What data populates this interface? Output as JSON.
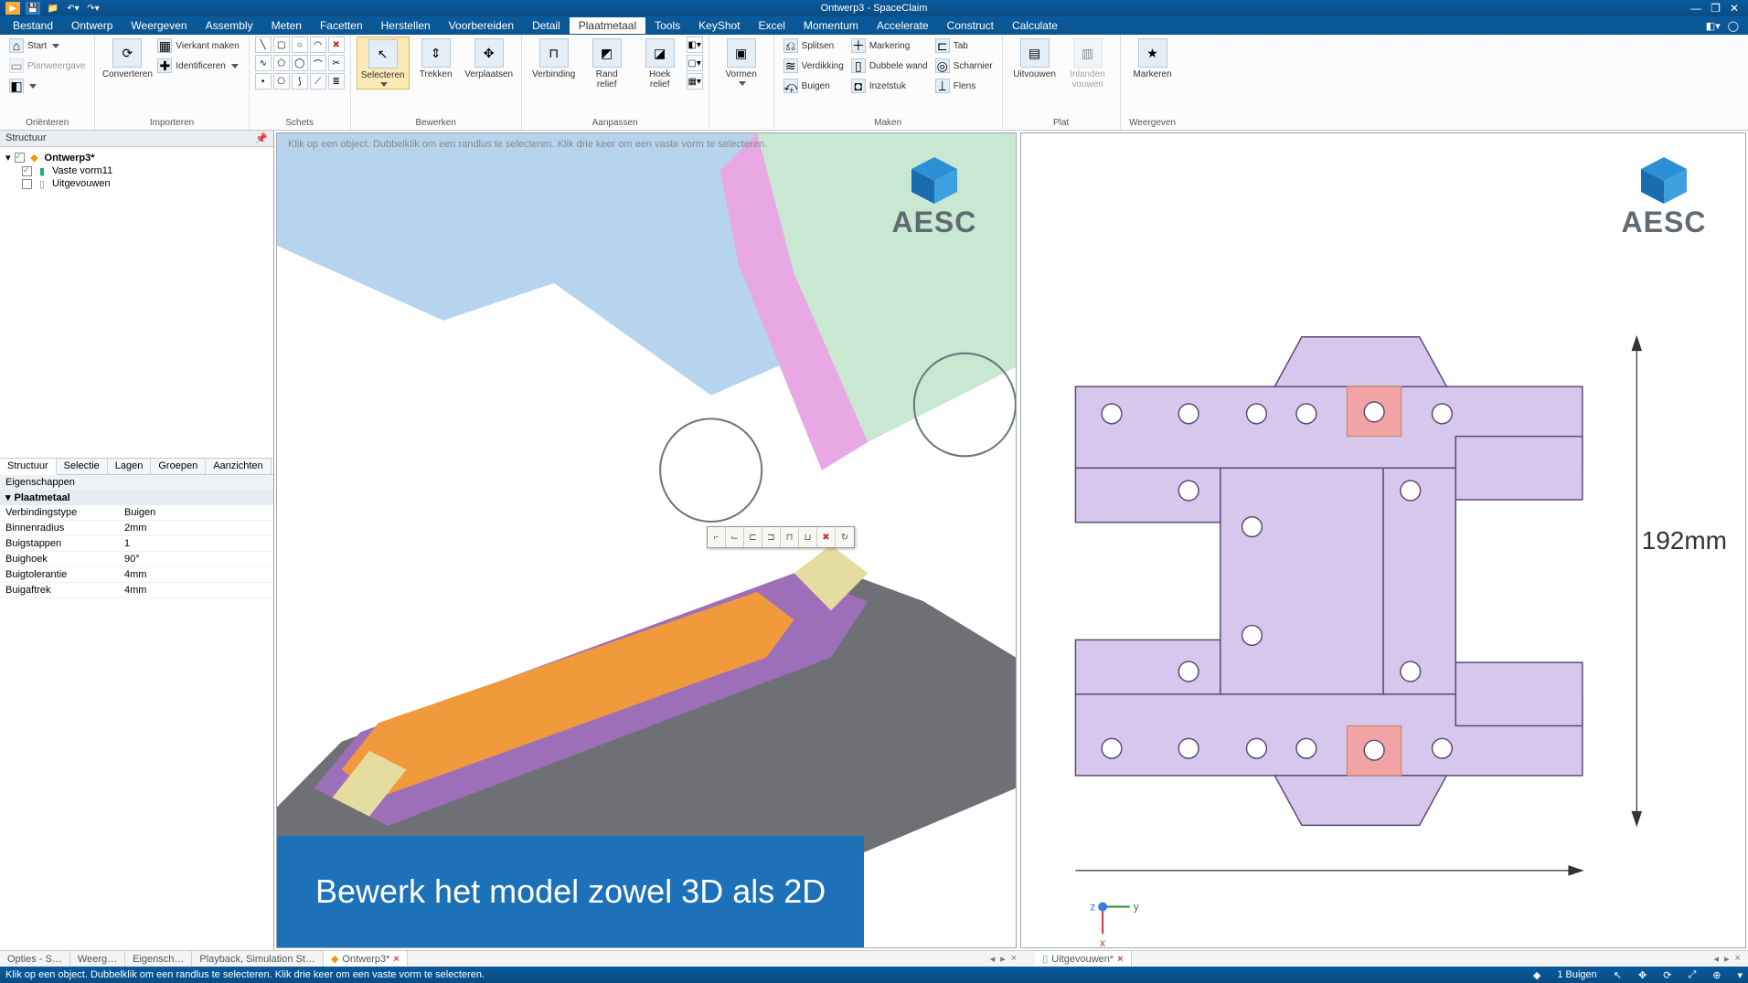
{
  "title": "Ontwerp3 - SpaceClaim",
  "menubar": [
    "Bestand",
    "Ontwerp",
    "Weergeven",
    "Assembly",
    "Meten",
    "Facetten",
    "Herstellen",
    "Voorbereiden",
    "Detail",
    "Plaatmetaal",
    "Tools",
    "KeyShot",
    "Excel",
    "Momentum",
    "Accelerate",
    "Construct",
    "Calculate"
  ],
  "menubar_active_index": 9,
  "ribbon": {
    "orienteren": {
      "start": "Start",
      "planweergave": "Planweergave",
      "orienteren_label": "Oriënteren"
    },
    "importeren": {
      "converteren": "Converteren",
      "vierkant": "Vierkant maken",
      "identificeren": "Identificeren",
      "label": "Importeren"
    },
    "schets": {
      "label": "Schets"
    },
    "bewerken": {
      "selecteren": "Selecteren",
      "trekken": "Trekken",
      "verplaatsen": "Verplaatsen",
      "label": "Bewerken"
    },
    "aanpassen": {
      "verbinding": "Verbinding",
      "randrelief": "Rand\nrelief",
      "hoekrelief": "Hoek\nrelief",
      "label": "Aanpassen"
    },
    "vormen": {
      "vormen": "Vormen",
      "label": ""
    },
    "maken": {
      "splitsen": "Splitsen",
      "markering": "Markering",
      "tab": "Tab",
      "verdikking": "Verdikking",
      "dubbelewand": "Dubbele wand",
      "scharnier": "Scharnier",
      "buigen": "Buigen",
      "inzetstuk": "Inzetstuk",
      "flens": "Flens",
      "label": "Maken"
    },
    "plat": {
      "uitvouwen": "Uitvouwen",
      "inlanden": "Inlanden\nvouwen",
      "label": "Plat"
    },
    "weergeven": {
      "markeren": "Markeren",
      "label": "Weergeven"
    }
  },
  "structure_panel": {
    "header": "Structuur",
    "root": "Ontwerp3*",
    "child1": "Vaste vorm11",
    "child2": "Uitgevouwen"
  },
  "tabs": [
    "Structuur",
    "Selectie",
    "Lagen",
    "Groepen",
    "Aanzichten"
  ],
  "tabs_active_index": 0,
  "properties": {
    "header": "Eigenschappen",
    "section": "Plaatmetaal",
    "rows": [
      {
        "k": "Verbindingstype",
        "v": "Buigen"
      },
      {
        "k": "Binnenradius",
        "v": "2mm"
      },
      {
        "k": "Buigstappen",
        "v": "1"
      },
      {
        "k": "Buighoek",
        "v": "90°"
      },
      {
        "k": "Buigtolerantie",
        "v": "4mm"
      },
      {
        "k": "Buigaftrek",
        "v": "4mm"
      }
    ]
  },
  "viewport_hint": "Klik op een object. Dubbelklik om een randlus te selecteren. Klik drie keer om een vaste vorm te selecteren.",
  "aesc": "AESC",
  "dimension": "192mm",
  "doc_tabs_left": [
    "Opties - S…",
    "Weerg…",
    "Eigensch…",
    "Playback, Simulation St…"
  ],
  "doc_tab_center": "Ontwerp3*",
  "doc_tab_right": "Uitgevouwen*",
  "caption": "Bewerk het model zowel 3D als 2D",
  "statusbar_hint": "Klik op een object. Dubbelklik om een randlus te selecteren. Klik drie keer om een vaste vorm te selecteren.",
  "statusbar_right": "1 Buigen",
  "axes": {
    "x": "x",
    "y": "y",
    "z": "z"
  }
}
